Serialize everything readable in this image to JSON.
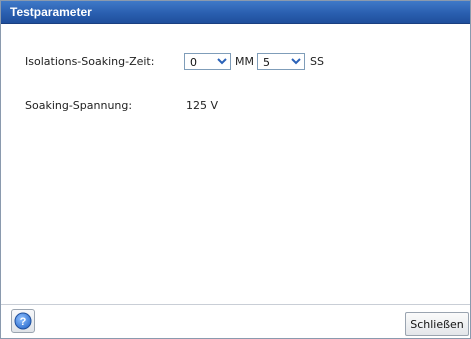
{
  "window": {
    "title": "Testparameter"
  },
  "soaking_time": {
    "label": "Isolations-Soaking-Zeit:",
    "minutes_value": "0",
    "minutes_unit": "MM",
    "seconds_value": "5",
    "seconds_unit": "SS"
  },
  "soaking_voltage": {
    "label": "Soaking-Spannung:",
    "value": "125 V"
  },
  "footer": {
    "help_icon": "question-mark-icon",
    "close_label": "Schließen"
  },
  "colors": {
    "titlebar": "#2a5fb0",
    "dropdown_arrow": "#2b62b8",
    "help_button": "#3a7bd5"
  }
}
